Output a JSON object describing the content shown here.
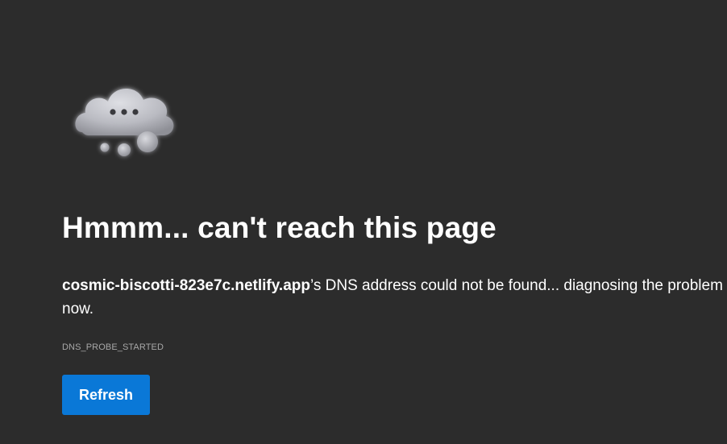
{
  "icon": "cloud-thinking-icon",
  "title": "Hmmm... can't reach this page",
  "message": {
    "host": "cosmic-biscotti-823e7c.netlify.app",
    "text": "’s DNS address could not be found... diagnosing the problem now."
  },
  "error_code": "DNS_PROBE_STARTED",
  "refresh_label": "Refresh",
  "colors": {
    "background": "#2c2c2c",
    "button": "#0a78d7",
    "error_code": "#a8a8a8"
  }
}
